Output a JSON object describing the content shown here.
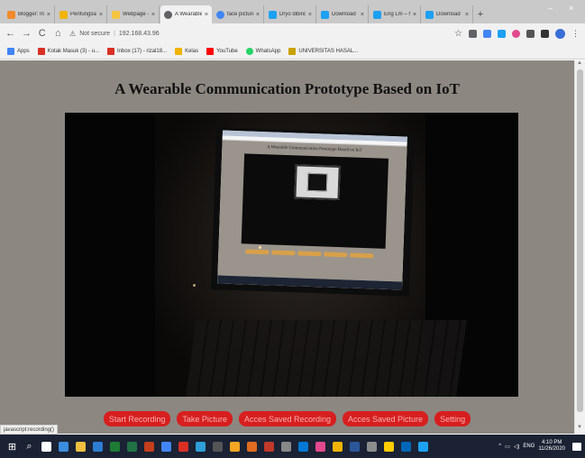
{
  "browser": {
    "tabs": [
      {
        "label": "Blogger: Inc",
        "color": "#f28b2c"
      },
      {
        "label": "Penfungsian",
        "color": "#f0b400"
      },
      {
        "label": "Webpage –",
        "color": "#f5c542"
      },
      {
        "label": "A Wearable",
        "color": "#5f6368",
        "active": true
      },
      {
        "label": "face picture",
        "color": "#4285f4"
      },
      {
        "label": "Dryo dibinc",
        "color": "#1da1f2"
      },
      {
        "label": "Download",
        "color": "#1da1f2"
      },
      {
        "label": "Eng Lm – N",
        "color": "#1da1f2"
      },
      {
        "label": "Download",
        "color": "#1da1f2"
      }
    ],
    "tab_close_glyph": "×",
    "new_tab_glyph": "+",
    "window_controls": {
      "minimize": "–",
      "close": "×"
    },
    "nav": {
      "back": "←",
      "forward": "→",
      "reload": "C",
      "home": "⌂"
    },
    "address": {
      "security": "Not secure",
      "url": "192.168.43.96"
    },
    "star_glyph": "☆",
    "bookmarks": [
      {
        "label": "Apps",
        "color": "#4285f4"
      },
      {
        "label": "Kotak Masuk (3) - u...",
        "color": "#d93025"
      },
      {
        "label": "Inbox (17) - rizal18...",
        "color": "#d93025"
      },
      {
        "label": "Kelas",
        "color": "#f0b400"
      },
      {
        "label": "YouTube",
        "color": "#ff0000"
      },
      {
        "label": "WhatsApp",
        "color": "#25d366"
      },
      {
        "label": "UNIVERSITAS HASAL...",
        "color": "#c9a100"
      }
    ],
    "status_text": "javascript:recording()"
  },
  "page": {
    "title": "A Wearable Communication Prototype Based on IoT",
    "embedded_screen_title": "A Wearable Communication Prototype Based on IoT",
    "buttons": [
      {
        "label": "Start Recording",
        "name": "start-recording-button"
      },
      {
        "label": "Take Picture",
        "name": "take-picture-button"
      },
      {
        "label": "Acces Saved Recording",
        "name": "access-saved-recording-button"
      },
      {
        "label": "Acces Saved Picture",
        "name": "access-saved-picture-button"
      },
      {
        "label": "Setting",
        "name": "setting-button"
      }
    ],
    "button_color": "#d71f1f"
  },
  "taskbar": {
    "start_glyph": "⊞",
    "search_glyph": "⌕",
    "app_colors": [
      "#ffffff",
      "#3c8dde",
      "#f0c040",
      "#2d7dd2",
      "#1e7b34",
      "#217346",
      "#c43e1c",
      "#4285f4",
      "#d93025",
      "#2f9fd8",
      "#555",
      "#f5a623",
      "#e06c1f",
      "#c0392b",
      "#888",
      "#0078d4",
      "#e24a8d",
      "#f0b400",
      "#2b579a",
      "#8c8c8c",
      "#ffcc00",
      "#0067b8",
      "#1da1f2"
    ],
    "tray_text": "ENG",
    "time": "4:10 PM",
    "date": "11/26/2020"
  }
}
